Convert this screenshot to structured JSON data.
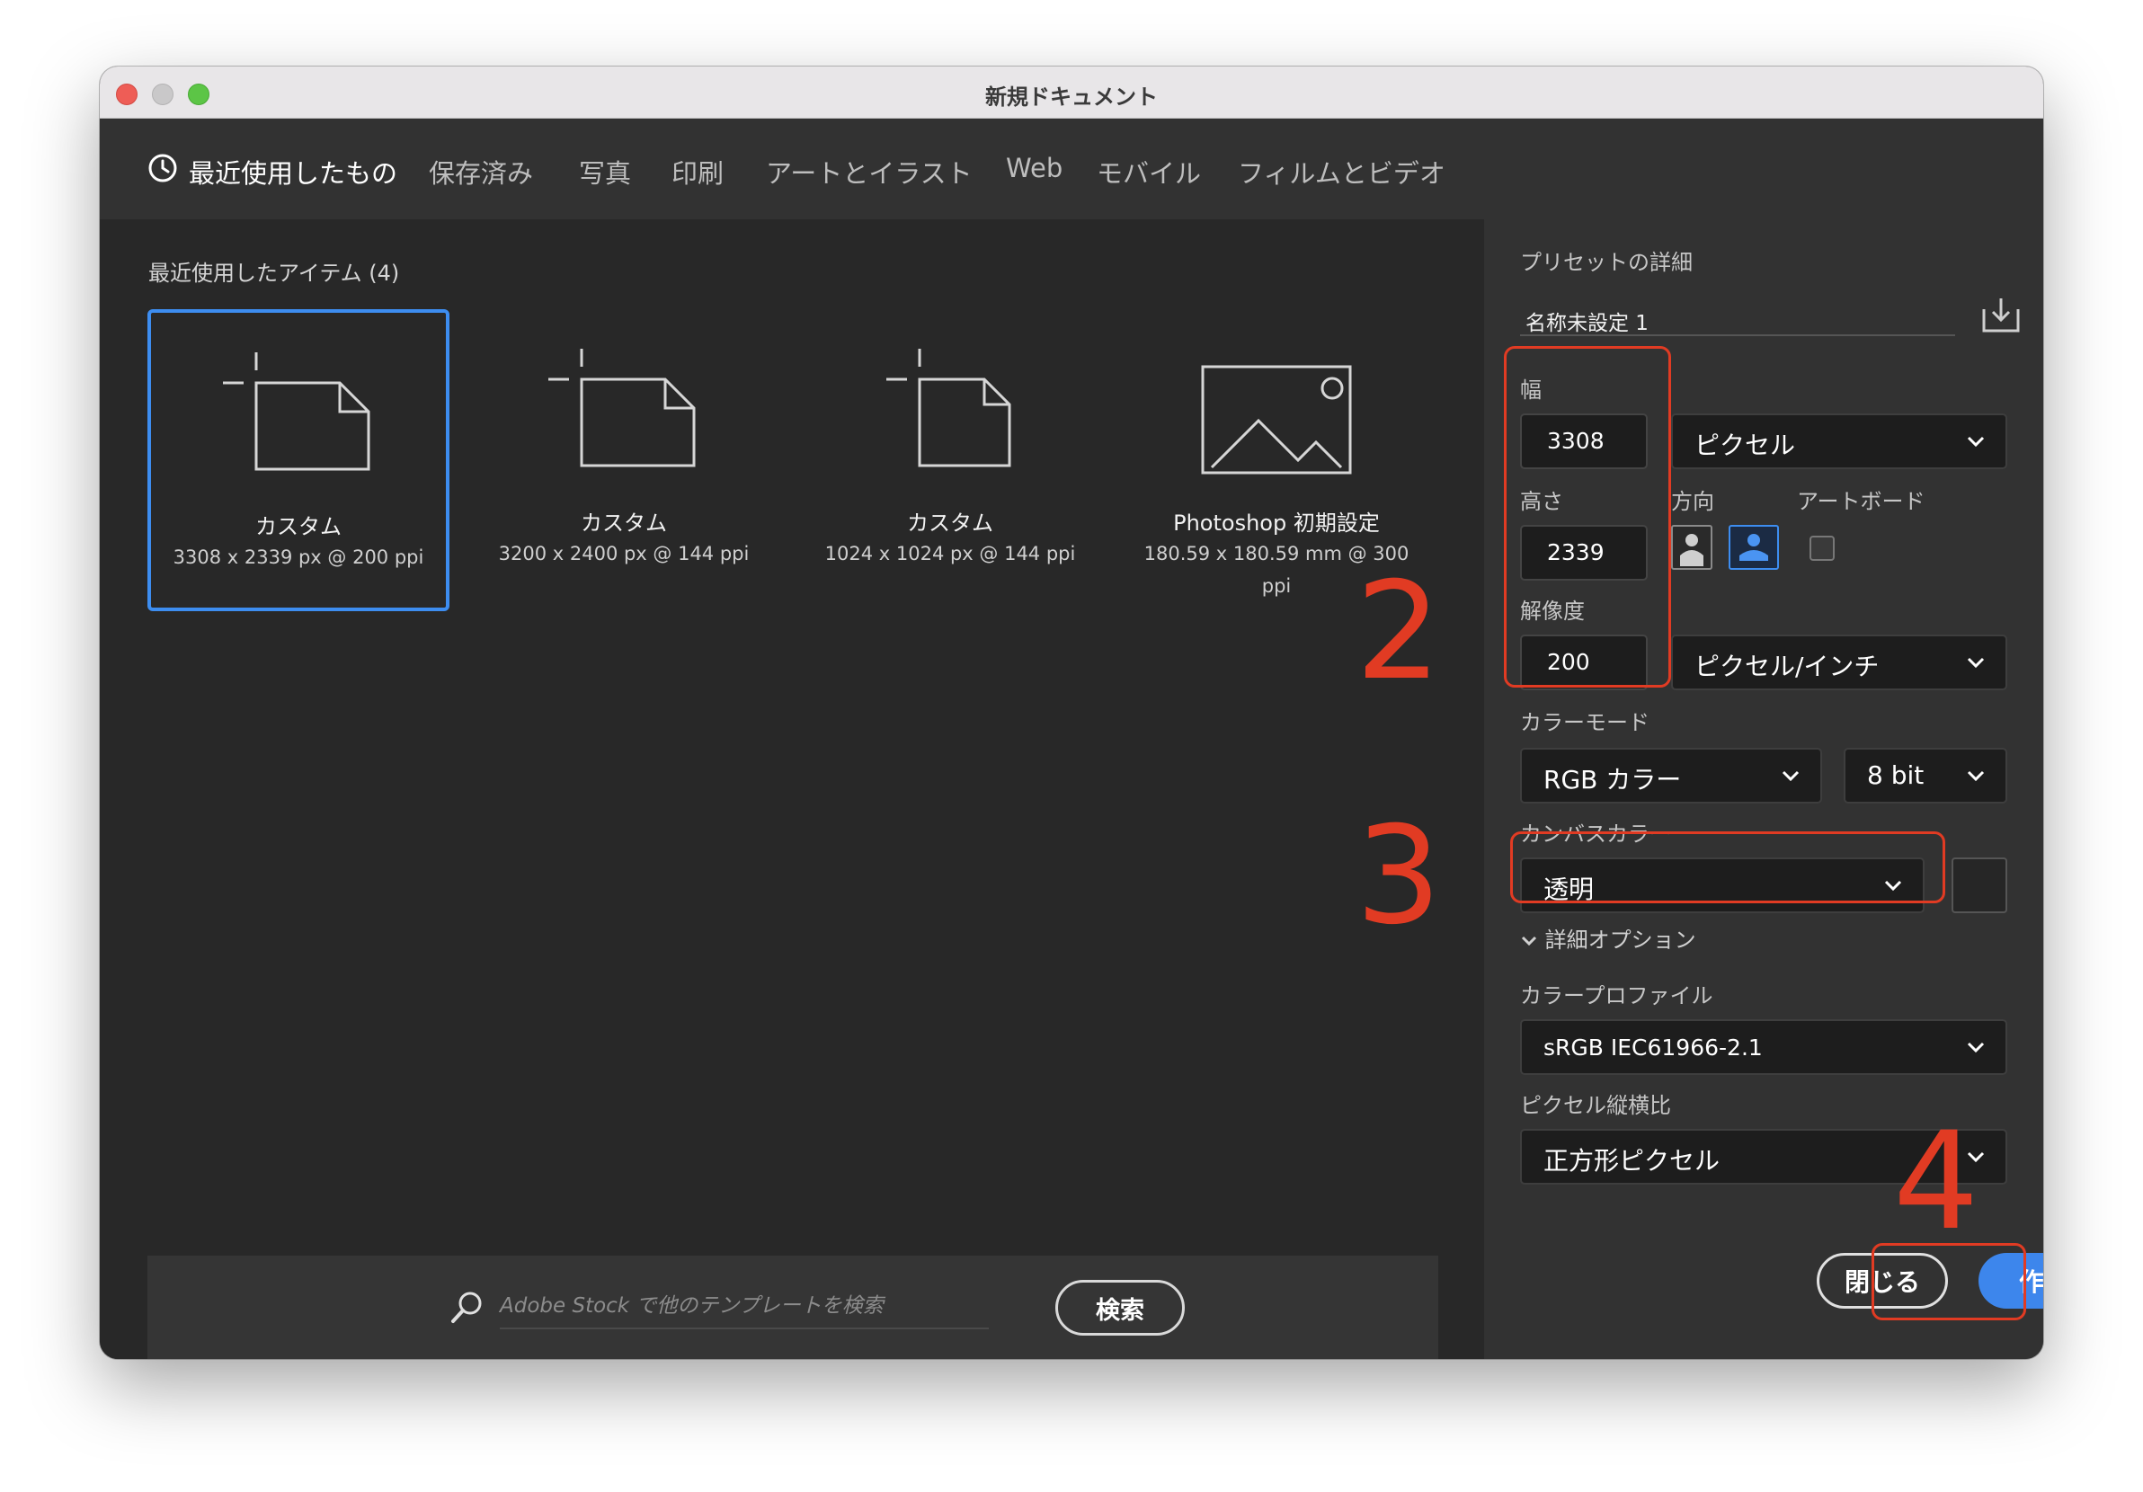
{
  "window": {
    "title": "新規ドキュメント"
  },
  "tabs": [
    {
      "label": "最近使用したもの",
      "active": true,
      "icon": "clock-icon"
    },
    {
      "label": "保存済み"
    },
    {
      "label": "写真"
    },
    {
      "label": "印刷"
    },
    {
      "label": "アートとイラスト"
    },
    {
      "label": "Web"
    },
    {
      "label": "モバイル"
    },
    {
      "label": "フィルムとビデオ"
    }
  ],
  "recent": {
    "heading": "最近使用したアイテム  (4)",
    "items": [
      {
        "name": "カスタム",
        "dims": "3308 x 2339 px @ 200 ppi",
        "icon": "document-icon"
      },
      {
        "name": "カスタム",
        "dims": "3200 x 2400 px @ 144 ppi",
        "icon": "document-icon"
      },
      {
        "name": "カスタム",
        "dims": "1024 x 1024 px @ 144 ppi",
        "icon": "document-icon"
      },
      {
        "name": "Photoshop 初期設定",
        "dims": "180.59 x 180.59 mm @ 300 ppi",
        "icon": "image-icon"
      }
    ]
  },
  "search": {
    "placeholder": "Adobe Stock で他のテンプレートを検索",
    "button": "検索"
  },
  "preset": {
    "section_title": "プリセットの詳細",
    "name": "名称未設定 1",
    "width_label": "幅",
    "width": "3308",
    "width_unit": "ピクセル",
    "height_label": "高さ",
    "height": "2339",
    "orientation_label": "方向",
    "artboard_label": "アートボード",
    "resolution_label": "解像度",
    "resolution": "200",
    "resolution_unit": "ピクセル/インチ",
    "color_mode_label": "カラーモード",
    "color_mode": "RGB カラー",
    "bit_depth": "8 bit",
    "canvas_color_label": "カンバスカラー",
    "canvas_color": "透明",
    "advanced_label": "詳細オプション",
    "color_profile_label": "カラープロファイル",
    "color_profile": "sRGB IEC61966-2.1",
    "pixel_aspect_label": "ピクセル縦横比",
    "pixel_aspect": "正方形ピクセル"
  },
  "actions": {
    "close": "閉じる",
    "create": "作成"
  },
  "annotations": [
    "2",
    "3",
    "4"
  ],
  "colors": {
    "accent": "#3d86ec",
    "annotation": "#e13b23"
  }
}
